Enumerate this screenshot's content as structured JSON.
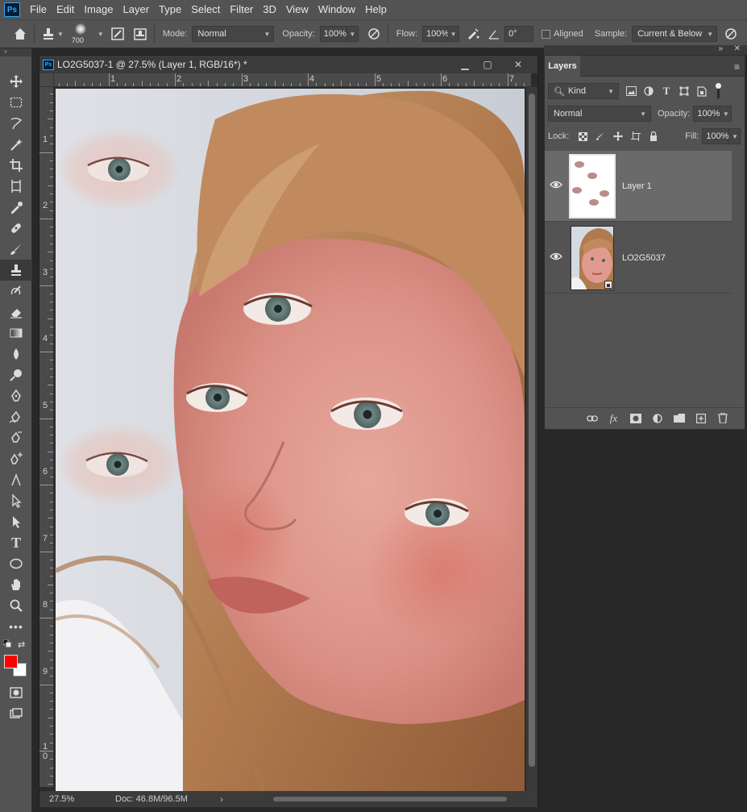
{
  "app": {
    "logo": "Ps"
  },
  "menu": [
    "File",
    "Edit",
    "Image",
    "Layer",
    "Type",
    "Select",
    "Filter",
    "3D",
    "View",
    "Window",
    "Help"
  ],
  "options": {
    "brush_size": "700",
    "mode_label": "Mode:",
    "mode_value": "Normal",
    "opacity_label": "Opacity:",
    "opacity_value": "100%",
    "flow_label": "Flow:",
    "flow_value": "100%",
    "angle_value": "0°",
    "aligned_label": "Aligned",
    "sample_label": "Sample:",
    "sample_value": "Current & Below"
  },
  "document": {
    "title": "LO2G5037-1 @ 27.5% (Layer 1, RGB/16*) *",
    "zoom": "27.5%",
    "doc_size": "Doc: 46.8M/96.5M",
    "ruler_top": [
      "1",
      "2",
      "3",
      "4",
      "5",
      "6",
      "7"
    ],
    "ruler_left": [
      "1",
      "2",
      "3",
      "4",
      "5",
      "6",
      "7",
      "8",
      "9",
      "1",
      "0"
    ]
  },
  "tools": [
    "move-tool",
    "marquee-tool",
    "lasso-tool",
    "magic-wand-tool",
    "crop-tool",
    "frame-tool",
    "eyedropper-tool",
    "healing-brush-tool",
    "brush-tool",
    "clone-stamp-tool",
    "history-brush-tool",
    "eraser-tool",
    "gradient-tool",
    "blur-tool",
    "dodge-tool",
    "pen-tool",
    "freeform-pen-tool",
    "curvature-pen-tool",
    "add-anchor-tool",
    "path-selection-tool",
    "direct-selection-tool",
    "type-tool",
    "ellipse-tool",
    "hand-tool",
    "zoom-tool",
    "more-tools"
  ],
  "colors": {
    "foreground": "#ff0000",
    "background": "#ffffff",
    "accent": "#31a8ff"
  },
  "layers_panel": {
    "tab": "Layers",
    "filter_kind": "Kind",
    "blend_mode": "Normal",
    "opacity_label": "Opacity:",
    "opacity_value": "100%",
    "lock_label": "Lock:",
    "fill_label": "Fill:",
    "fill_value": "100%",
    "layers": [
      {
        "name": "Layer 1",
        "selected": true,
        "visible": true
      },
      {
        "name": "LO2G5037",
        "selected": false,
        "visible": true
      }
    ]
  }
}
